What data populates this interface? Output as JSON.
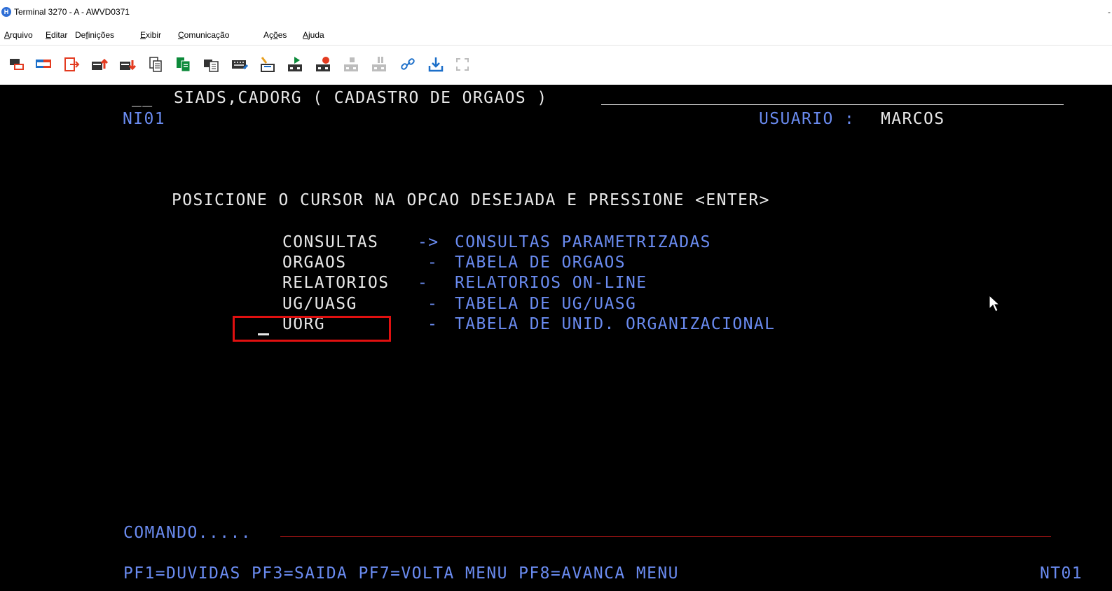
{
  "window": {
    "title": "Terminal 3270 - A - AWVD0371",
    "app_icon": "H",
    "minimize": "-"
  },
  "menu": [
    {
      "u": "A",
      "rest": "rquivo"
    },
    {
      "u": "E",
      "rest": "ditar"
    },
    {
      "pre": "De",
      "u": "f",
      "rest": "inições"
    },
    {
      "u": "E",
      "rest": "xibir"
    },
    {
      "u": "C",
      "rest": "omunicação"
    },
    {
      "pre": "Aç",
      "u": "õ",
      "rest": "es"
    },
    {
      "u": "A",
      "rest": "juda"
    }
  ],
  "toolbar_icons": [
    "connect-icon",
    "session-icon",
    "disconnect-icon",
    "send-file-icon",
    "receive-file-icon",
    "copy-icon",
    "paste-icon",
    "copy-append-icon",
    "keyboard-icon",
    "clear-icon",
    "play-macro-icon",
    "record-macro-icon",
    "stop-macro-icon",
    "pause-macro-icon",
    "link-icon",
    "download-icon",
    "refresh-icon"
  ],
  "terminal": {
    "header_prefix": "__",
    "header_title": "SIADS,CADORG ( CADASTRO DE ORGAOS )",
    "screen_id": "NI01",
    "user_label": "USUARIO :",
    "user_name": "MARCOS",
    "instruction": "POSICIONE O CURSOR NA OPCAO DESEJADA E PRESSIONE <ENTER>",
    "options": [
      {
        "name": "CONSULTAS",
        "sep": "->",
        "desc": "CONSULTAS PARAMETRIZADAS"
      },
      {
        "name": "ORGAOS",
        "sep": "-",
        "desc": "TABELA DE ORGAOS"
      },
      {
        "name": "RELATORIOS",
        "sep": "-",
        "desc": "RELATORIOS ON-LINE"
      },
      {
        "name": "UG/UASG",
        "sep": "-",
        "desc": "TABELA DE UG/UASG"
      },
      {
        "name": "UORG",
        "sep": "-",
        "desc": "TABELA DE UNID. ORGANIZACIONAL"
      }
    ],
    "command_label": "COMANDO.....",
    "pf_keys": "PF1=DUVIDAS PF3=SAIDA PF7=VOLTA MENU PF8=AVANCA MENU",
    "terminal_id": "NT01"
  },
  "colors": {
    "highlight": "#e01010",
    "blue_text": "#6a8bf0",
    "white_text": "#e8e8e8",
    "command_line": "#c01818"
  }
}
